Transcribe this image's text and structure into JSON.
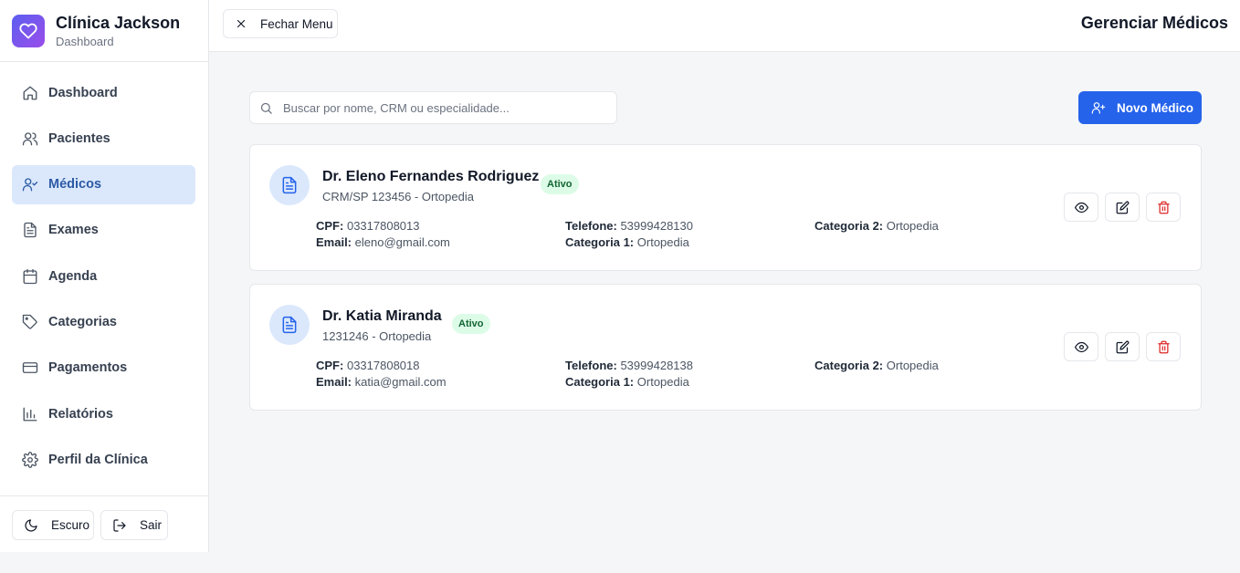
{
  "brand": {
    "title": "Clínica Jackson",
    "subtitle": "Dashboard"
  },
  "sidebar": {
    "items": [
      {
        "label": "Dashboard",
        "icon": "home-icon"
      },
      {
        "label": "Pacientes",
        "icon": "users-icon"
      },
      {
        "label": "Médicos",
        "icon": "user-check-icon",
        "active": true
      },
      {
        "label": "Exames",
        "icon": "file-text-icon"
      },
      {
        "label": "Agenda",
        "icon": "calendar-icon"
      },
      {
        "label": "Categorias",
        "icon": "tag-icon"
      },
      {
        "label": "Pagamentos",
        "icon": "credit-card-icon"
      },
      {
        "label": "Relatórios",
        "icon": "bar-chart-icon"
      },
      {
        "label": "Perfil da Clínica",
        "icon": "gear-icon"
      }
    ],
    "footer": {
      "theme_label": "Escuro",
      "logout_label": "Sair"
    }
  },
  "topbar": {
    "menu_label": "Fechar Menu",
    "title": "Gerenciar Médicos"
  },
  "search": {
    "placeholder": "Buscar por nome, CRM ou especialidade...",
    "value": ""
  },
  "new_button": {
    "label": "Novo Médico"
  },
  "colors": {
    "primary": "#2563eb",
    "active_bg": "#dbe8fc",
    "badge_bg": "#dcfce7",
    "danger": "#dc2626"
  },
  "doctors": [
    {
      "name": "Dr. Eleno Fernandes Rodriguez",
      "status": "Ativo",
      "crm": "CRM/SP 123456 - Ortopedia",
      "cpf_label": "CPF:",
      "cpf": "03317808013",
      "email_label": "Email:",
      "email": "eleno@gmail.com",
      "phone_label": "Telefone:",
      "phone": "53999428130",
      "cat1_label": "Categoria 1:",
      "cat1": "Ortopedia",
      "cat2_label": "Categoria 2:",
      "cat2": "Ortopedia"
    },
    {
      "name": "Dr. Katia Miranda",
      "status": "Ativo",
      "crm": "1231246 - Ortopedia",
      "cpf_label": "CPF:",
      "cpf": "03317808018",
      "email_label": "Email:",
      "email": "katia@gmail.com",
      "phone_label": "Telefone:",
      "phone": "53999428138",
      "cat1_label": "Categoria 1:",
      "cat1": "Ortopedia",
      "cat2_label": "Categoria 2:",
      "cat2": "Ortopedia"
    }
  ]
}
